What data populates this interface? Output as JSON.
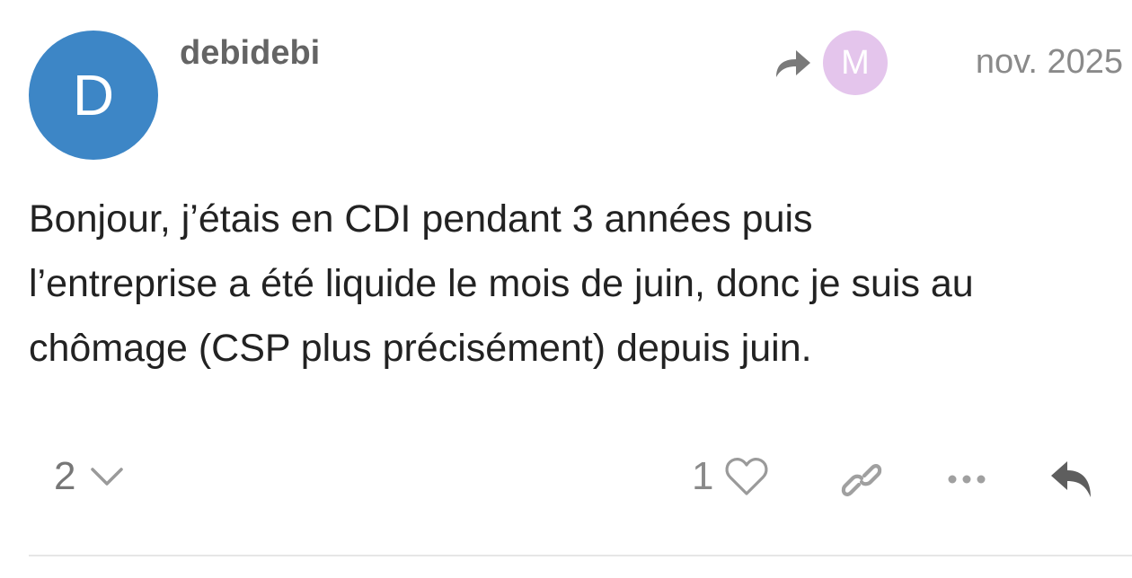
{
  "post": {
    "author": {
      "username": "debidebi",
      "avatar_letter": "D",
      "avatar_color": "#3d86c6"
    },
    "reply_to": {
      "avatar_letter": "M",
      "avatar_color": "#e4c5ec",
      "icon": "share-arrow-icon"
    },
    "date": "nov. 2025",
    "body": [
      "Bonjour, j’étais en CDI pendant 3 années puis",
      "l’entreprise a été liquide le mois de juin, donc je suis au",
      "chômage (CSP plus précisément) depuis juin."
    ]
  },
  "actions": {
    "replies_count": "2",
    "likes_count": "1",
    "icons": [
      "chevron-down-icon",
      "heart-icon",
      "link-icon",
      "more-icon",
      "reply-icon"
    ]
  }
}
